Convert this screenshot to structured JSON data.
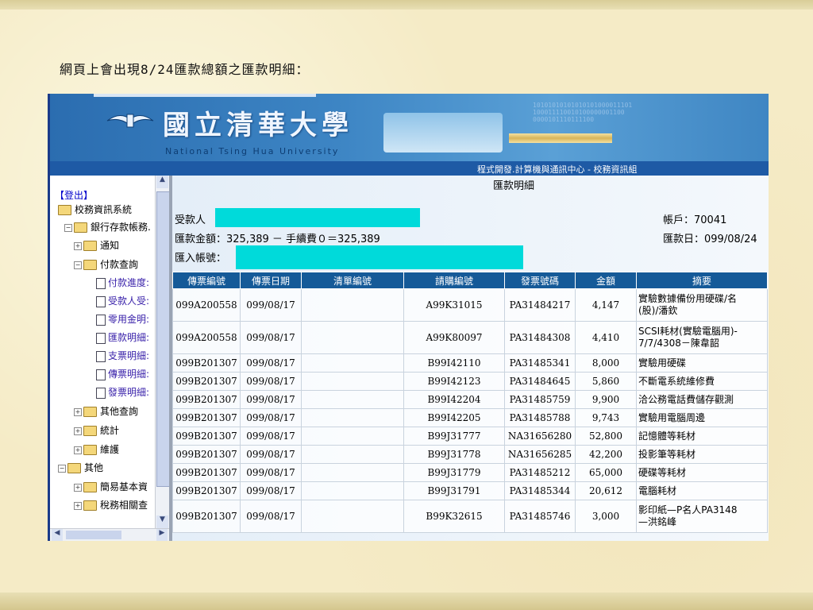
{
  "caption": "網頁上會出現8/24匯款總額之匯款明細：",
  "banner": {
    "title": "國立清華大學",
    "subtitle": "National Tsing Hua University",
    "org": "程式開發.計算機與通訊中心 - 校務資訊組",
    "binary_lines": [
      "10101010101010101000011101",
      "100011110010100000001100",
      "0000101110111100"
    ]
  },
  "tree": {
    "logout": "【登出】",
    "items": [
      "校務資訊系統",
      "銀行存款帳務.",
      "通知",
      "付款查詢",
      "付款進度:",
      "受款人受:",
      "零用金明:",
      "匯款明細:",
      "支票明細:",
      "傳票明細:",
      "發票明細:",
      "其他查詢",
      "統計",
      "維護",
      "其他",
      "簡易基本資",
      "稅務相關查"
    ]
  },
  "main": {
    "page_title": "匯款明細",
    "payee_label": "受款人",
    "amount_line": "匯款金額：325,389 － 手續費０＝325,389",
    "account_label": "匯入帳號：",
    "account_no_label": "帳戶：70041",
    "remit_date_label": "匯款日：099/08/24",
    "columns": [
      "傳票編號",
      "傳票日期",
      "清單編號",
      "請購編號",
      "發票號碼",
      "金額",
      "摘要"
    ],
    "rows": [
      {
        "voucher": "099A200558",
        "date": "099/08/17",
        "list": "",
        "req": "A99K31015",
        "invoice": "PA31484217",
        "amount": "4,147",
        "summary": "實驗數據備份用硬碟/名\n(股)/潘欽"
      },
      {
        "voucher": "099A200558",
        "date": "099/08/17",
        "list": "",
        "req": "A99K80097",
        "invoice": "PA31484308",
        "amount": "4,410",
        "summary": "SCSI耗材(實驗電腦用)-\n7/7/4308－陳韋韶"
      },
      {
        "voucher": "099B201307",
        "date": "099/08/17",
        "list": "",
        "req": "B99I42110",
        "invoice": "PA31485341",
        "amount": "8,000",
        "summary": "實驗用硬碟"
      },
      {
        "voucher": "099B201307",
        "date": "099/08/17",
        "list": "",
        "req": "B99I42123",
        "invoice": "PA31484645",
        "amount": "5,860",
        "summary": "不斷電系統維修費"
      },
      {
        "voucher": "099B201307",
        "date": "099/08/17",
        "list": "",
        "req": "B99I42204",
        "invoice": "PA31485759",
        "amount": "9,900",
        "summary": "洽公務電話費儲存觀測"
      },
      {
        "voucher": "099B201307",
        "date": "099/08/17",
        "list": "",
        "req": "B99I42205",
        "invoice": "PA31485788",
        "amount": "9,743",
        "summary": "實驗用電腦周邊"
      },
      {
        "voucher": "099B201307",
        "date": "099/08/17",
        "list": "",
        "req": "B99J31777",
        "invoice": "NA31656280",
        "amount": "52,800",
        "summary": "記憶體等耗材"
      },
      {
        "voucher": "099B201307",
        "date": "099/08/17",
        "list": "",
        "req": "B99J31778",
        "invoice": "NA31656285",
        "amount": "42,200",
        "summary": "投影筆等耗材"
      },
      {
        "voucher": "099B201307",
        "date": "099/08/17",
        "list": "",
        "req": "B99J31779",
        "invoice": "PA31485212",
        "amount": "65,000",
        "summary": "硬碟等耗材"
      },
      {
        "voucher": "099B201307",
        "date": "099/08/17",
        "list": "",
        "req": "B99J31791",
        "invoice": "PA31485344",
        "amount": "20,612",
        "summary": "電腦耗材"
      },
      {
        "voucher": "099B201307",
        "date": "099/08/17",
        "list": "",
        "req": "B99K32615",
        "invoice": "PA31485746",
        "amount": "3,000",
        "summary": "影印紙—P名人PA3148\n—洪銘峰"
      }
    ]
  },
  "colors": {
    "header_blue": "#155a98",
    "masked_cyan": "#00dada",
    "banner_blue": "#3d85c4"
  }
}
